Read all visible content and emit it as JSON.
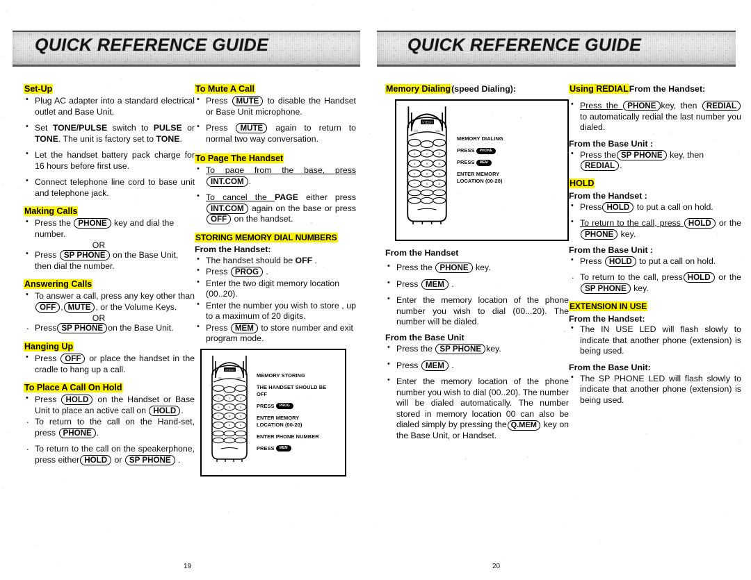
{
  "document": {
    "left_page": {
      "header": "QUICK REFERENCE GUIDE",
      "page_number": "19"
    },
    "right_page": {
      "header": "QUICK REFERENCE GUIDE",
      "page_number": "20"
    }
  },
  "colors": {
    "highlight": "#fff200",
    "text": "#0a0a0a",
    "band": "#e6e6e6"
  },
  "col1": {
    "setup": {
      "title": "Set-Up",
      "b1": "Plug AC adapter into a standard electrical outlet and Base Unit.",
      "b2_a": "Set ",
      "b2_b": "TONE/PULSE",
      "b2_c": " switch to ",
      "b2_d": "PULSE",
      "b2_e": " or ",
      "b2_f": "TONE",
      "b2_g": ". The unit is factory set to ",
      "b2_h": "TONE",
      "b2_i": ".",
      "b3": "Let the handset battery pack charge for 16 hours before first use.",
      "b4": "Connect telephone line cord to base unit and telephone jack."
    },
    "making_calls": {
      "title": "Making Calls",
      "b1_a": "Press the ",
      "b1_key": "PHONE",
      "b1_b": " key and dial the number.",
      "or": "OR",
      "b2_a": "Press ",
      "b2_key": "SP PHONE",
      "b2_b": " on the Base Unit, then dial the number."
    },
    "answering_calls": {
      "title": "Answering Calls",
      "b1_a": "To answer a call, press any key other than ",
      "b1_key1": "OFF",
      "b1_mid": ",",
      "b1_key2": "MUTE",
      "b1_b": ", or the Volume Keys.",
      "or": "OR",
      "b2_a": "Press",
      "b2_key": "SP PHONE",
      "b2_b": "on the Base Unit."
    },
    "hanging_up": {
      "title": "Hanging Up",
      "b1_a": "Press ",
      "b1_key": "OFF",
      "b1_b": " or place the handset in the cradle to hang up a call."
    },
    "hold": {
      "title": "To Place A Call On Hold",
      "b1_a": "Press ",
      "b1_key1": "HOLD",
      "b1_b": " on the Handset or Base Unit to place an active call on ",
      "b1_key2": "HOLD",
      "b1_c": ".",
      "b2_a": "To return to the call on the Hand-set, press ",
      "b2_key": "PHONE",
      "b2_b": ".",
      "b3_a": "To return to the call on the speakerphone, press either",
      "b3_key1": "HOLD",
      "b3_b": " or ",
      "b3_key2": "SP PHONE",
      "b3_c": " ."
    }
  },
  "col2": {
    "mute": {
      "title": "To Mute A Call",
      "b1_a": "Press ",
      "b1_key": "MUTE",
      "b1_b": " to disable the Handset or Base Unit microphone.",
      "b2_a": "Press ",
      "b2_key": "MUTE",
      "b2_b": " again to return to normal two way conversation."
    },
    "page_handset": {
      "title": "To Page The Handset",
      "b1_a": "To page from the base, press ",
      "b1_key": "INT.COM",
      "b1_b": ".",
      "b2_a": "To cancel the ",
      "b2_bold": "PAGE",
      "b2_b": " either press ",
      "b2_key1": "INT.COM",
      "b2_c": " again on the base or press ",
      "b2_key2": "OFF",
      "b2_d": " on the handset."
    },
    "storing": {
      "title": "STORING MEMORY DIAL NUMBERS",
      "subhead": "From the Handset:",
      "b1_a": "The handset should be ",
      "b1_bold": "OFF",
      "b1_b": " .",
      "b2_a": "Press ",
      "b2_key": "PROG",
      "b2_b": " .",
      "b3": "Enter the two digit memory location (00..20).",
      "b4": "Enter the number you wish to store , up to a maximum of 20 digits.",
      "b5_a": "Press ",
      "b5_key": "MEM",
      "b5_b": " to store number and exit program mode."
    },
    "diagram": {
      "title": "MEMORY STORING",
      "line1": "THE HANDSET SHOULD BE",
      "line1b": "OFF",
      "line2": "PRESS",
      "line2_key": "PROG",
      "line3": "ENTER MEMORY",
      "line3b": "LOCATION (00-20)",
      "line4": "ENTER PHONE NUMBER",
      "line5": "PRESS",
      "line5_key": "MEM",
      "display": "VTECH"
    }
  },
  "col3": {
    "memory_dialing": {
      "title": "Memory Dialing",
      "title_rest": "(speed Dialing):"
    },
    "diagram": {
      "title": "MEMORY DIALING",
      "line1": "PRESS",
      "line1_key": "PHONE",
      "line2": "PRESS",
      "line2_key": "MEM",
      "line3": "ENTER MEMORY",
      "line3b": "LOCATION (00-20)",
      "display": "VTECH"
    },
    "from_handset": {
      "title": "From the Handset",
      "b1_a": "Press the ",
      "b1_key": "PHONE",
      "b1_b": " key.",
      "b2_a": "Press ",
      "b2_key": "MEM",
      "b2_b": " .",
      "b3": "Enter the memory location of the phone number you wish to dial (00...20). The number will be dialed."
    },
    "from_base": {
      "title": "From the Base Unit",
      "b1_a": "Press the ",
      "b1_key": "SP PHONE",
      "b1_b": "key.",
      "b2_a": "Press ",
      "b2_key": "MEM",
      "b2_b": " .",
      "b3_a": "Enter the memory location of the phone number you wish to dial (00..20). The number will be dialed automatically. The number stored in memory location 00 can also be dialed simply by pressing the",
      "b3_key": "Q.MEM",
      "b3_b": " key on the Base Unit, or Handset."
    }
  },
  "col4": {
    "redial": {
      "title": "Using REDIAL",
      "title_rest": "From the Handset:",
      "b1_a": "Press the ",
      "b1_key1": "PHONE",
      "b1_b": "key, then ",
      "b1_key2": "REDIAL",
      "b1_c": " to automatically redial the last number you dialed.",
      "base_title": "From the Base Unit :",
      "b2_a": "Press the",
      "b2_key1": "SP PHONE",
      "b2_b": " key, then ",
      "b2_key2": "REDIAL",
      "b2_c": "."
    },
    "hold": {
      "title": "HOLD",
      "handset_title": "From the Handset :",
      "b1_a": "Press",
      "b1_key": "HOLD",
      "b1_b": " to put a call on hold.",
      "b2_a": "To return to the call, press ",
      "b2_key1": "HOLD",
      "b2_b": " or  the ",
      "b2_key2": "PHONE",
      "b2_c": " key.",
      "base_title": "From the Base Unit :",
      "b3_a": "Press ",
      "b3_key": "HOLD",
      "b3_b": " to put a call on hold.",
      "b4_a": "To return to the call, press",
      "b4_key1": "HOLD",
      "b4_b": " or the ",
      "b4_key2": "SP PHONE",
      "b4_c": " key."
    },
    "extension": {
      "title": "EXTENSION IN USE",
      "handset_title": "From the Handset:",
      "b1": "The IN USE LED will flash slowly to indicate that another phone (extension) is being used.",
      "base_title": "From the Base Unit:",
      "b2": "The SP PHONE LED will flash slowly to indicate that another phone (extension) is being used."
    }
  }
}
